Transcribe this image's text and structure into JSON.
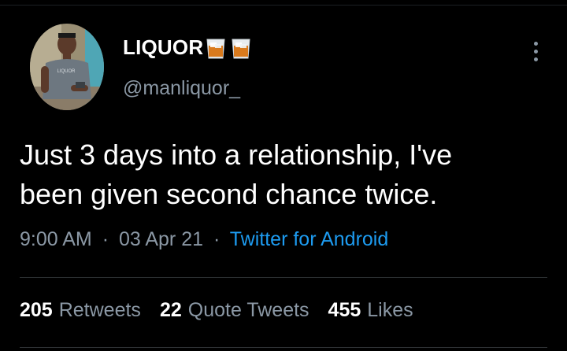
{
  "author": {
    "display_name": "LIQUOR",
    "handle": "@manliquor_",
    "emojis": [
      "whisky-glass-icon",
      "whisky-glass-icon"
    ],
    "avatar_shirt_text": "LIQUOR"
  },
  "tweet": {
    "text": "Just 3 days into a relationship, I've\nbeen given second chance twice."
  },
  "meta": {
    "time": "9:00 AM",
    "date": "03 Apr 21",
    "separator": "·",
    "source": "Twitter for Android"
  },
  "stats": {
    "retweets_count": "205",
    "retweets_label": "Retweets",
    "quotes_count": "22",
    "quotes_label": "Quote Tweets",
    "likes_count": "455",
    "likes_label": "Likes"
  },
  "colors": {
    "background": "#000000",
    "primary_text": "#ffffff",
    "secondary_text": "#8b98a5",
    "link": "#1d9bf0",
    "divider": "#2f3336"
  }
}
